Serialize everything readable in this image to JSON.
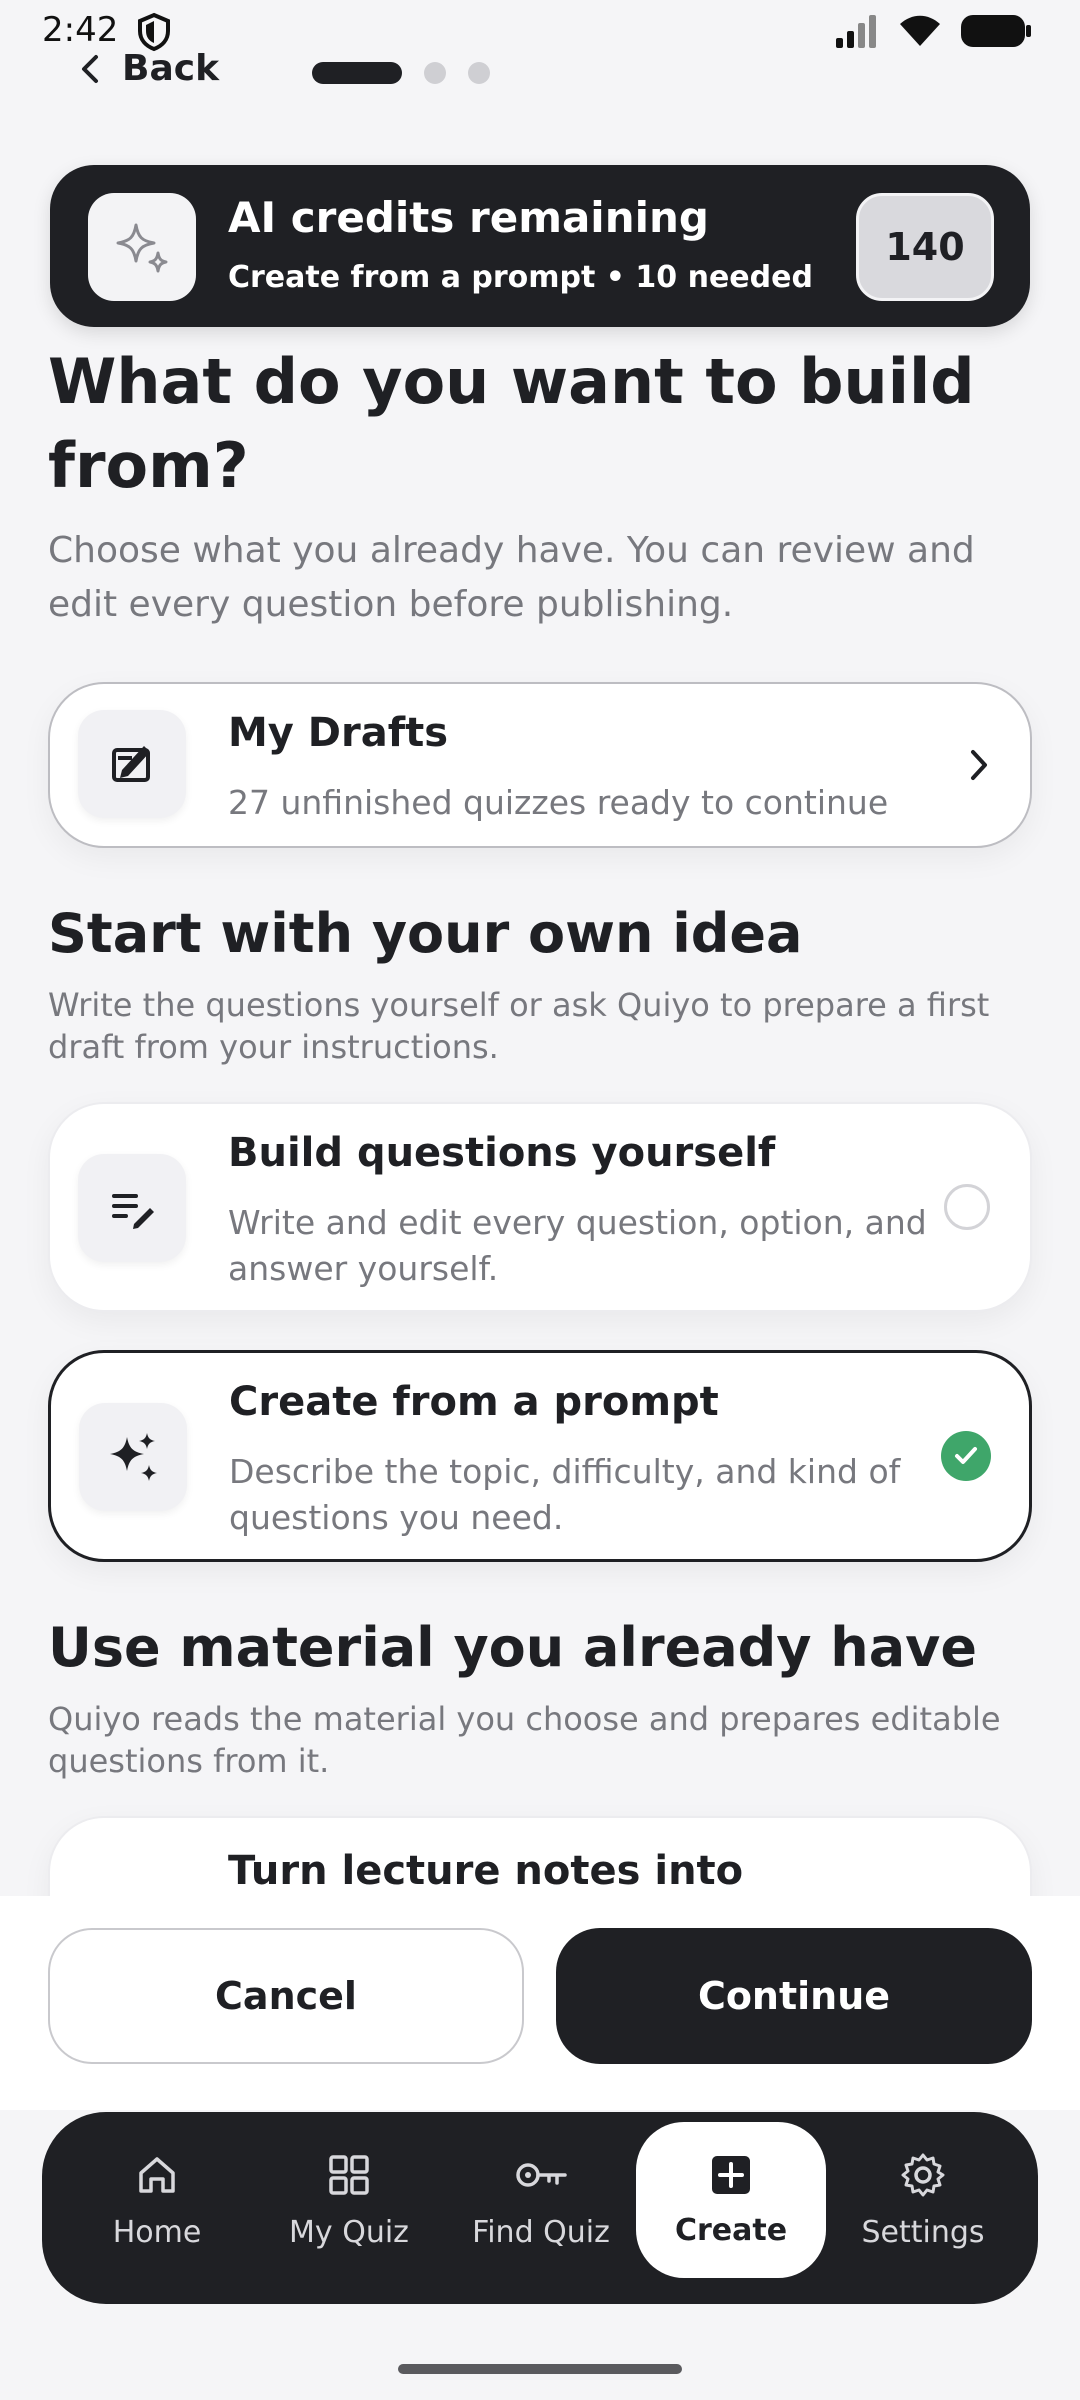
{
  "status": {
    "time": "2:42"
  },
  "nav": {
    "back_label": "Back",
    "steps": 3,
    "active_step": 1
  },
  "credits": {
    "title": "AI credits remaining",
    "subtitle": "Create from a prompt • 10 needed",
    "count": "140"
  },
  "header": {
    "title": "What do you want to build from?",
    "lead": "Choose what you already have. You can review and edit every question before publishing."
  },
  "drafts": {
    "title": "My Drafts",
    "desc": "27 unfinished quizzes ready to continue"
  },
  "section_own": {
    "title": "Start with your own idea",
    "desc": "Write the questions yourself or ask Quiyo to prepare a first draft from your instructions.",
    "options": [
      {
        "title": "Build questions yourself",
        "desc": "Write and edit every question, option, and answer yourself.",
        "selected": false
      },
      {
        "title": "Create from a prompt",
        "desc": "Describe the topic, difficulty, and kind of questions you need.",
        "selected": true
      }
    ]
  },
  "section_material": {
    "title": "Use material you already have",
    "desc": "Quiyo reads the material you choose and prepares editable questions from it.",
    "options": [
      {
        "title": "Turn lecture notes into"
      }
    ]
  },
  "actions": {
    "cancel": "Cancel",
    "continue": "Continue"
  },
  "tabs": [
    {
      "label": "Home",
      "icon": "home-icon",
      "active": false
    },
    {
      "label": "My Quiz",
      "icon": "grid-icon",
      "active": false
    },
    {
      "label": "Find Quiz",
      "icon": "key-icon",
      "active": false
    },
    {
      "label": "Create",
      "icon": "plus-square-icon",
      "active": true
    },
    {
      "label": "Settings",
      "icon": "gear-icon",
      "active": false
    }
  ],
  "colors": {
    "accent": "#1f2024",
    "success": "#3fa66a",
    "background": "#f5f5f7"
  }
}
